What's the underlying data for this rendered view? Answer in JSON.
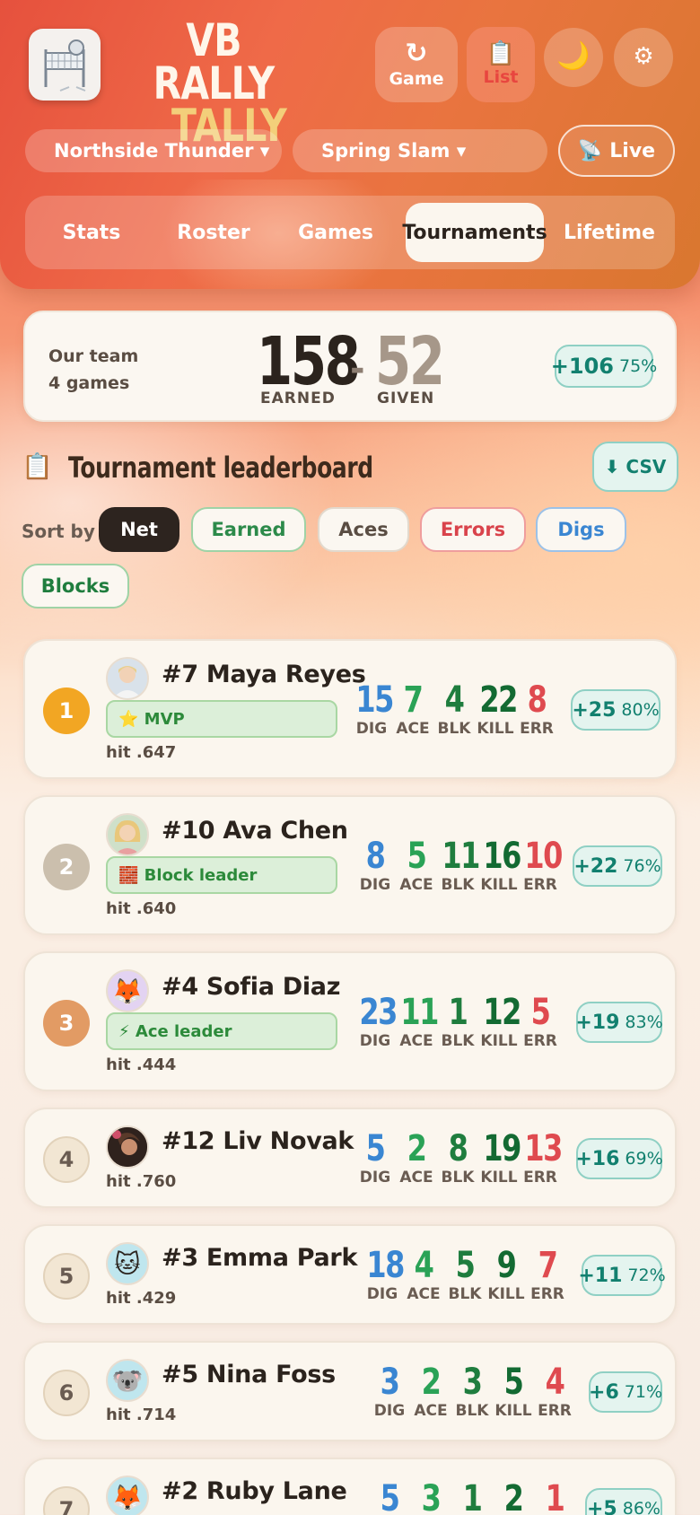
{
  "app": {
    "title_line1": "VB RALLY",
    "title_line2": "TALLY"
  },
  "header_buttons": {
    "game_label": "Game",
    "list_label": "List"
  },
  "selectors": {
    "team": "Northside Thunder ▾",
    "tournament": "Spring Slam ▾",
    "live_label": "Live"
  },
  "tabs": [
    {
      "label": "Stats"
    },
    {
      "label": "Roster"
    },
    {
      "label": "Games"
    },
    {
      "label": "Tournaments",
      "active": true
    },
    {
      "label": "Lifetime"
    }
  ],
  "summary": {
    "team_label": "Our team",
    "games": "4 games",
    "earned": "158",
    "given": "52",
    "earned_label": "EARNED",
    "given_label": "GIVEN",
    "net": "+106",
    "pct": "75%"
  },
  "leaderboard": {
    "title": "Tournament leaderboard",
    "csv_label": "⬇ CSV",
    "sort_label": "Sort by",
    "sort_options": [
      "Net",
      "Earned",
      "Aces",
      "Errors",
      "Digs",
      "Blocks"
    ],
    "stat_keys": {
      "dig": "DIG",
      "ace": "ACE",
      "blk": "BLK",
      "kill": "KILL",
      "err": "ERR"
    },
    "players": [
      {
        "rank": "1",
        "name": "#7 Maya Reyes",
        "award": "⭐ MVP",
        "hit": "hit .647",
        "dig": "15",
        "ace": "7",
        "blk": "4",
        "kill": "22",
        "err": "8",
        "net": "+25",
        "pct": "80%"
      },
      {
        "rank": "2",
        "name": "#10 Ava Chen",
        "award": "🧱 Block leader",
        "hit": "hit .640",
        "dig": "8",
        "ace": "5",
        "blk": "11",
        "kill": "16",
        "err": "10",
        "net": "+22",
        "pct": "76%"
      },
      {
        "rank": "3",
        "name": "#4 Sofia Diaz",
        "award": "⚡ Ace leader",
        "hit": "hit .444",
        "dig": "23",
        "ace": "11",
        "blk": "1",
        "kill": "12",
        "err": "5",
        "net": "+19",
        "pct": "83%"
      },
      {
        "rank": "4",
        "name": "#12 Liv Novak",
        "hit": "hit .760",
        "dig": "5",
        "ace": "2",
        "blk": "8",
        "kill": "19",
        "err": "13",
        "net": "+16",
        "pct": "69%"
      },
      {
        "rank": "5",
        "name": "#3 Emma Park",
        "hit": "hit .429",
        "dig": "18",
        "ace": "4",
        "blk": "5",
        "kill": "9",
        "err": "7",
        "net": "+11",
        "pct": "72%"
      },
      {
        "rank": "6",
        "name": "#5 Nina Foss",
        "hit": "hit .714",
        "dig": "3",
        "ace": "2",
        "blk": "3",
        "kill": "5",
        "err": "4",
        "net": "+6",
        "pct": "71%"
      },
      {
        "rank": "7",
        "name": "#2 Ruby Lane",
        "dig": "5",
        "ace": "3",
        "blk": "1",
        "kill": "2",
        "err": "1",
        "net": "+5",
        "pct": "86%"
      }
    ]
  },
  "colors": {
    "accent_teal": "#12806f",
    "dig": "#3a86d2",
    "ace": "#2aa256",
    "blk": "#1f7d3e",
    "kill": "#136a32",
    "err": "#df4a4f"
  }
}
